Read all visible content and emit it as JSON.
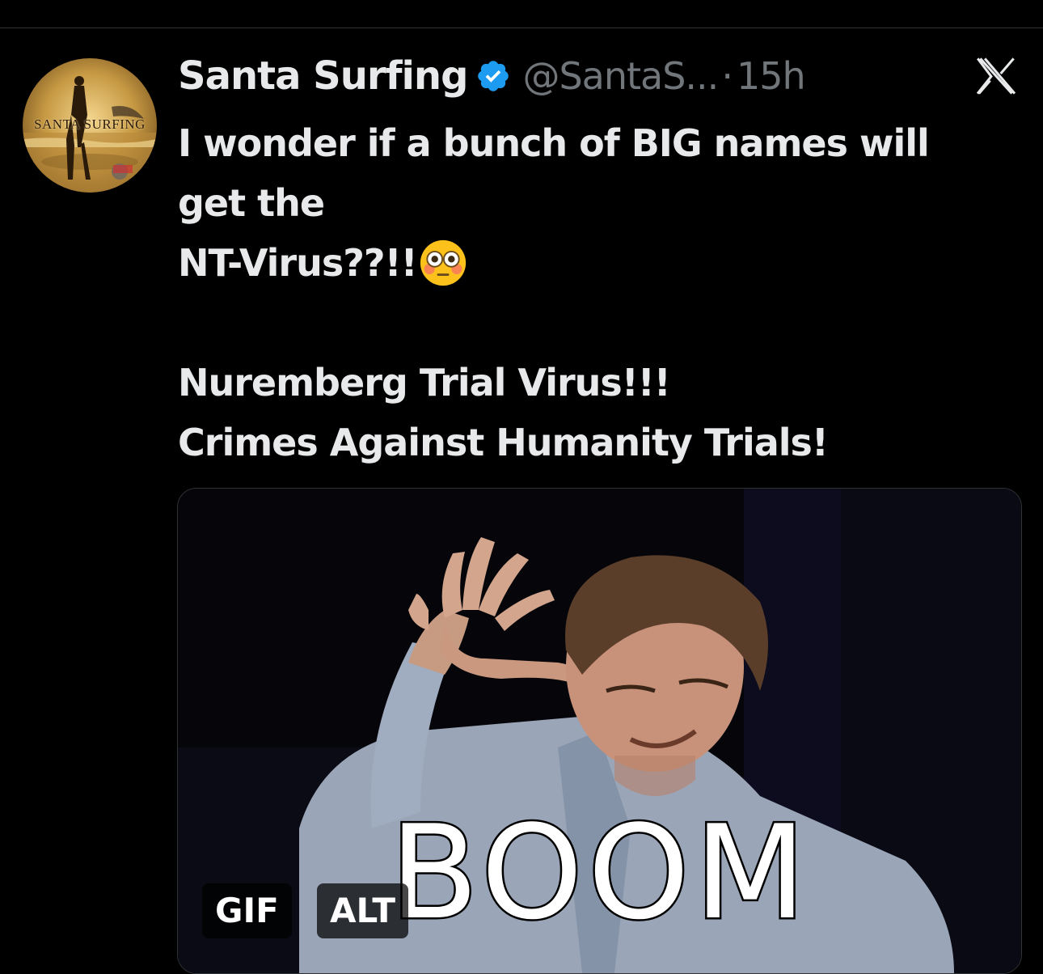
{
  "tweet": {
    "display_name": "Santa Surfing",
    "verified_icon": "verified-badge-icon",
    "handle": "@SantaS...",
    "separator": "·",
    "timestamp": "15h",
    "avatar_text": "SANTA SURFING",
    "body_lines": [
      "I wonder if a bunch of BIG names will",
      "get the",
      "NT-Virus??!!",
      "",
      "Nuremberg Trial Virus!!!",
      "Crimes Against Humanity Trials!"
    ],
    "emoji_icon": "flushed-face-emoji"
  },
  "close_icon": "x-logo-icon",
  "media": {
    "caption_text": "BOOM",
    "gif_badge": "GIF",
    "alt_badge": "ALT"
  },
  "colors": {
    "background": "#000000",
    "primary_text": "#e7e9ea",
    "secondary_text": "#71767b",
    "verified_blue": "#1d9bf0",
    "border": "#2f3336"
  }
}
